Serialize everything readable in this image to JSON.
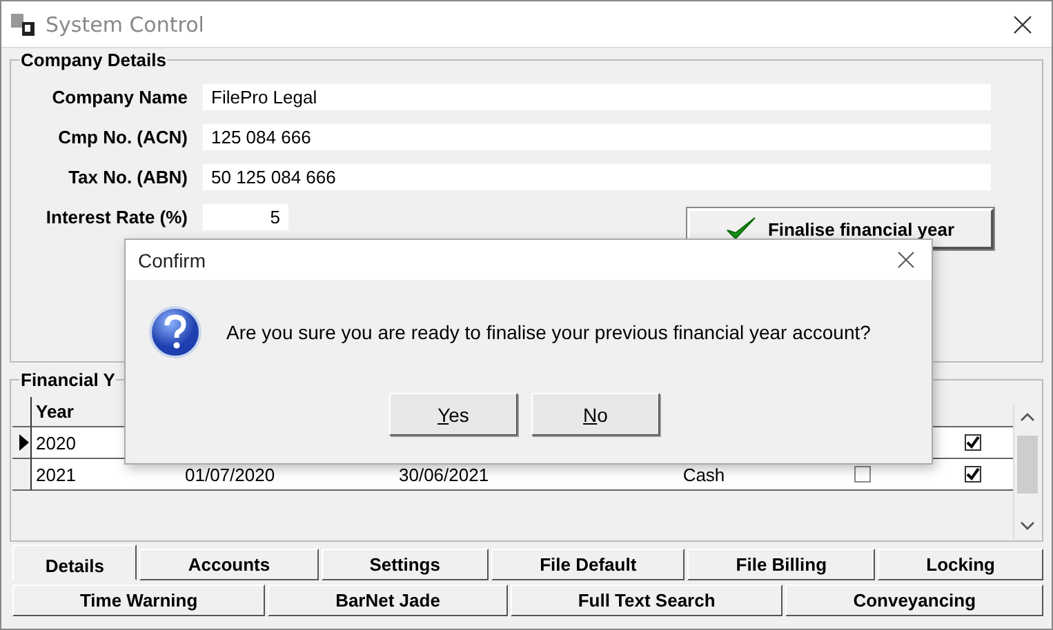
{
  "window": {
    "title": "System Control"
  },
  "company_details": {
    "title": "Company Details",
    "fields": [
      {
        "label": "Company Name",
        "value": "FilePro Legal"
      },
      {
        "label": "Cmp No. (ACN)",
        "value": "125 084 666"
      },
      {
        "label": "Tax No. (ABN)",
        "value": "50 125 084 666"
      },
      {
        "label": "Interest Rate (%)",
        "value": "5",
        "kind": "short"
      }
    ],
    "finalise_button": "Finalise financial year"
  },
  "financial_years": {
    "title": "Financial Y",
    "columns": [
      "Year"
    ],
    "rows": [
      {
        "current": true,
        "year": "2020",
        "column_6": true
      },
      {
        "current": false,
        "year": "2021",
        "column_2": "01/07/2020",
        "column_3": "30/06/2021",
        "column_4": "Cash",
        "column_5": false,
        "column_6": true
      }
    ]
  },
  "tabs": [
    [
      {
        "label": "Details",
        "selected": true
      },
      {
        "label": "Accounts",
        "selected": false
      },
      {
        "label": "Settings",
        "selected": false
      },
      {
        "label": "File Default",
        "selected": false
      },
      {
        "label": "File Billing",
        "selected": false
      },
      {
        "label": "Locking",
        "selected": false
      }
    ],
    [
      {
        "label": "Time Warning",
        "selected": false
      },
      {
        "label": "BarNet Jade",
        "selected": false
      },
      {
        "label": "Full Text Search",
        "selected": false
      },
      {
        "label": "Conveyancing",
        "selected": false
      }
    ]
  ],
  "dialog": {
    "title": "Confirm",
    "message": "Are you sure you are ready to finalise your previous financial year account?",
    "buttons": [
      "Yes",
      "No"
    ]
  }
}
